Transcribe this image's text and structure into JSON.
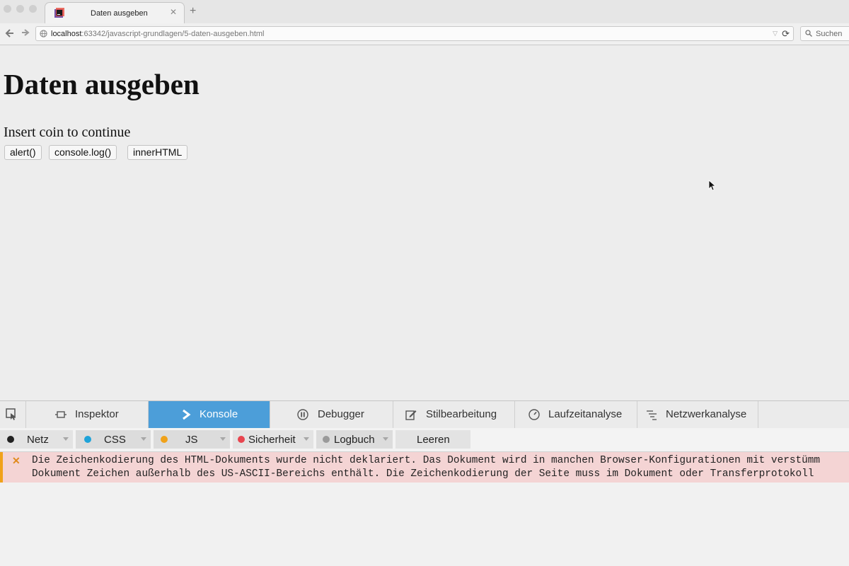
{
  "browser": {
    "tab": {
      "title": "Daten ausgeben"
    },
    "url": {
      "host": "localhost",
      "path": ":63342/javascript-grundlagen/5-daten-ausgeben.html"
    },
    "search": {
      "placeholder": "Suchen"
    },
    "colors": {
      "chrome": "#e6e6e6",
      "toolbar": "#f0f0f0"
    }
  },
  "page": {
    "heading": "Daten ausgeben",
    "paragraph": "Insert coin to continue",
    "buttons": [
      {
        "label": "alert()"
      },
      {
        "label": "console.log()"
      },
      {
        "label": "innerHTML"
      }
    ]
  },
  "devtools": {
    "active_tab": "Konsole",
    "accent_color": "#4c9ed9",
    "tabs": [
      {
        "label": "Inspektor",
        "icon": "inspector-icon"
      },
      {
        "label": "Konsole",
        "icon": "console-icon"
      },
      {
        "label": "Debugger",
        "icon": "debugger-icon"
      },
      {
        "label": "Stilbearbeitung",
        "icon": "style-editor-icon"
      },
      {
        "label": "Laufzeitanalyse",
        "icon": "performance-icon"
      },
      {
        "label": "Netzwerkanalyse",
        "icon": "network-icon"
      }
    ],
    "filters": [
      {
        "label": "Netz",
        "color": "#222222"
      },
      {
        "label": "CSS",
        "color": "#1fa3d9"
      },
      {
        "label": "JS",
        "color": "#f0a21a"
      },
      {
        "label": "Sicherheit",
        "color": "#e8454f"
      },
      {
        "label": "Logbuch",
        "color": "#9a9a9a"
      }
    ],
    "clear_label": "Leeren",
    "message": {
      "level": "warning",
      "color": "#f4d4d4",
      "line1": "Die Zeichenkodierung des HTML-Dokuments wurde nicht deklariert. Das Dokument wird in manchen Browser-Konfigurationen mit verstümm",
      "line2": "Dokument Zeichen außerhalb des US-ASCII-Bereichs enthält. Die Zeichenkodierung der Seite muss im Dokument oder Transferprotokoll"
    }
  }
}
